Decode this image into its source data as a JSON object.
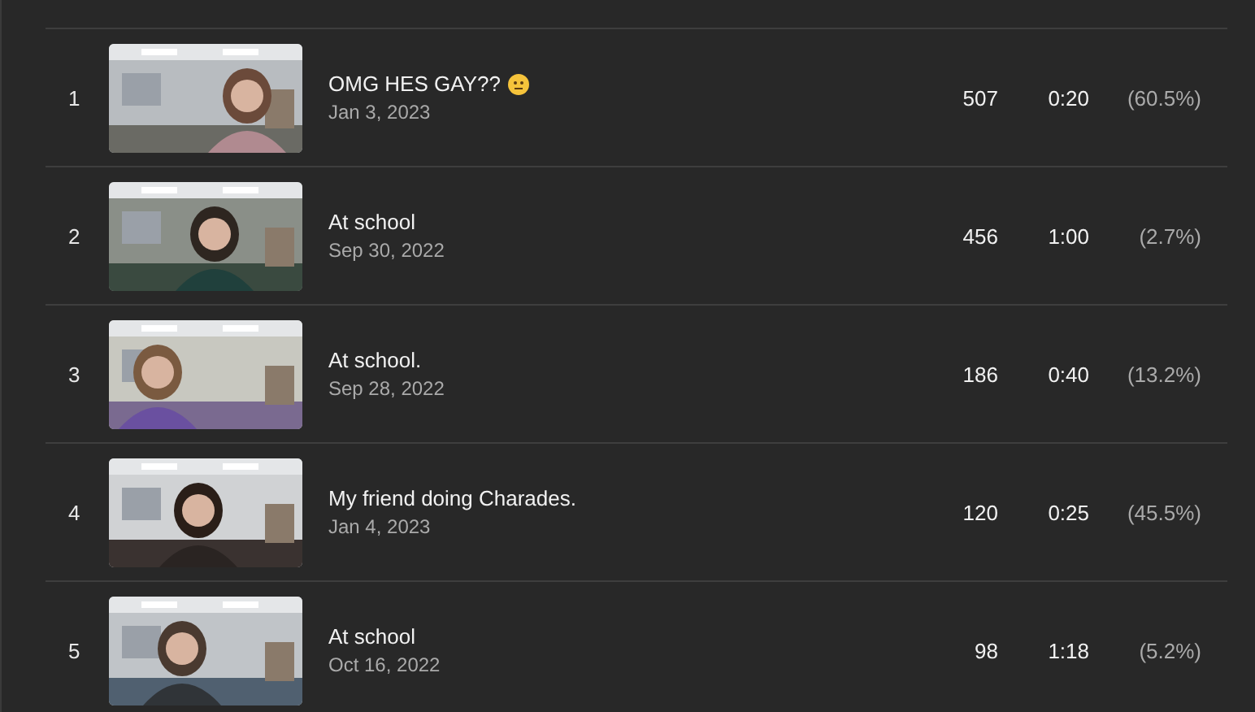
{
  "rows": [
    {
      "index": "1",
      "title": "OMG HES GAY??",
      "emoji": true,
      "date": "Jan 3, 2023",
      "views": "507",
      "duration": "0:20",
      "percent": "(60.5%)"
    },
    {
      "index": "2",
      "title": "At school",
      "emoji": false,
      "date": "Sep 30, 2022",
      "views": "456",
      "duration": "1:00",
      "percent": "(2.7%)"
    },
    {
      "index": "3",
      "title": "At school.",
      "emoji": false,
      "date": "Sep 28, 2022",
      "views": "186",
      "duration": "0:40",
      "percent": "(13.2%)"
    },
    {
      "index": "4",
      "title": "My friend doing Charades.",
      "emoji": false,
      "date": "Jan 4, 2023",
      "views": "120",
      "duration": "0:25",
      "percent": "(45.5%)"
    },
    {
      "index": "5",
      "title": "At school",
      "emoji": false,
      "date": "Oct 16, 2022",
      "views": "98",
      "duration": "1:18",
      "percent": "(5.2%)"
    }
  ]
}
